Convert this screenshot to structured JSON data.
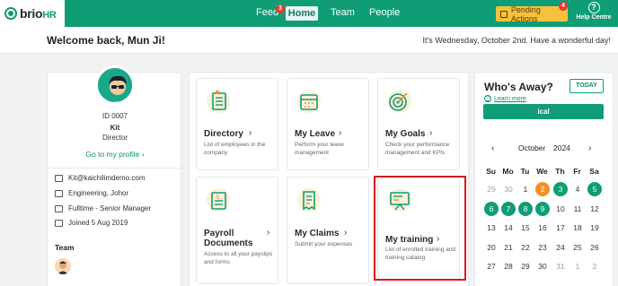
{
  "topbar": {
    "logo_text": "brio",
    "logo_suffix": "HR",
    "nav": [
      {
        "label": "Feed",
        "badge": "3"
      },
      {
        "label": "Home"
      },
      {
        "label": "Team"
      },
      {
        "label": "People"
      }
    ],
    "pending_label": "Pending Actions",
    "pending_badge": "4",
    "help_label": "Help Centre",
    "help_icon": "?"
  },
  "welcome": {
    "title": "Welcome back, Mun Ji!",
    "date_text": "It's Wednesday, October 2nd. Have a wonderful day!"
  },
  "profile": {
    "id_text": "ID 0007",
    "name": "Kit",
    "role": "Director",
    "profile_link": "Go to my profile",
    "email": "Kit@kaichilimdemo.com",
    "department": "Engineering, Johor",
    "employment": "Fulltime - Senior Manager",
    "joined": "Joined 5 Aug 2019",
    "team_label": "Team"
  },
  "tiles": [
    {
      "title": "Directory",
      "desc": "List of employees in the company",
      "icon": "directory-icon"
    },
    {
      "title": "My Leave",
      "desc": "Perform your leave management",
      "icon": "calendar-icon"
    },
    {
      "title": "My Goals",
      "desc": "Check your performance management and KPIs",
      "icon": "target-icon"
    },
    {
      "title": "Payroll Documents",
      "desc": "Access to all your payslips and forms",
      "icon": "payroll-icon"
    },
    {
      "title": "My Claims",
      "desc": "Submit your expenses",
      "icon": "receipt-icon"
    },
    {
      "title": "My training",
      "desc": "List of enrolled training and training catalog",
      "icon": "training-icon"
    }
  ],
  "who_away": {
    "title": "Who's Away?",
    "today_label": "TODAY",
    "learn_more": "Learn more",
    "ical_label": "ical",
    "month": "October",
    "year": "2024",
    "weekdays": [
      "Su",
      "Mo",
      "Tu",
      "We",
      "Th",
      "Fr",
      "Sa"
    ],
    "weeks": [
      [
        {
          "d": "29",
          "s": "muted"
        },
        {
          "d": "30",
          "s": "muted"
        },
        {
          "d": "1",
          "s": ""
        },
        {
          "d": "2",
          "s": "today"
        },
        {
          "d": "3",
          "s": "green"
        },
        {
          "d": "4",
          "s": ""
        },
        {
          "d": "5",
          "s": "green"
        }
      ],
      [
        {
          "d": "6",
          "s": "green"
        },
        {
          "d": "7",
          "s": "green"
        },
        {
          "d": "8",
          "s": "green"
        },
        {
          "d": "9",
          "s": "green"
        },
        {
          "d": "10",
          "s": ""
        },
        {
          "d": "11",
          "s": ""
        },
        {
          "d": "12",
          "s": ""
        }
      ],
      [
        {
          "d": "13",
          "s": ""
        },
        {
          "d": "14",
          "s": ""
        },
        {
          "d": "15",
          "s": ""
        },
        {
          "d": "16",
          "s": ""
        },
        {
          "d": "17",
          "s": ""
        },
        {
          "d": "18",
          "s": ""
        },
        {
          "d": "19",
          "s": ""
        }
      ],
      [
        {
          "d": "20",
          "s": ""
        },
        {
          "d": "21",
          "s": ""
        },
        {
          "d": "22",
          "s": ""
        },
        {
          "d": "23",
          "s": ""
        },
        {
          "d": "24",
          "s": ""
        },
        {
          "d": "25",
          "s": ""
        },
        {
          "d": "26",
          "s": ""
        }
      ],
      [
        {
          "d": "27",
          "s": ""
        },
        {
          "d": "28",
          "s": ""
        },
        {
          "d": "29",
          "s": ""
        },
        {
          "d": "30",
          "s": ""
        },
        {
          "d": "31",
          "s": "muted"
        },
        {
          "d": "1",
          "s": "muted"
        },
        {
          "d": "2",
          "s": "muted"
        }
      ]
    ]
  }
}
